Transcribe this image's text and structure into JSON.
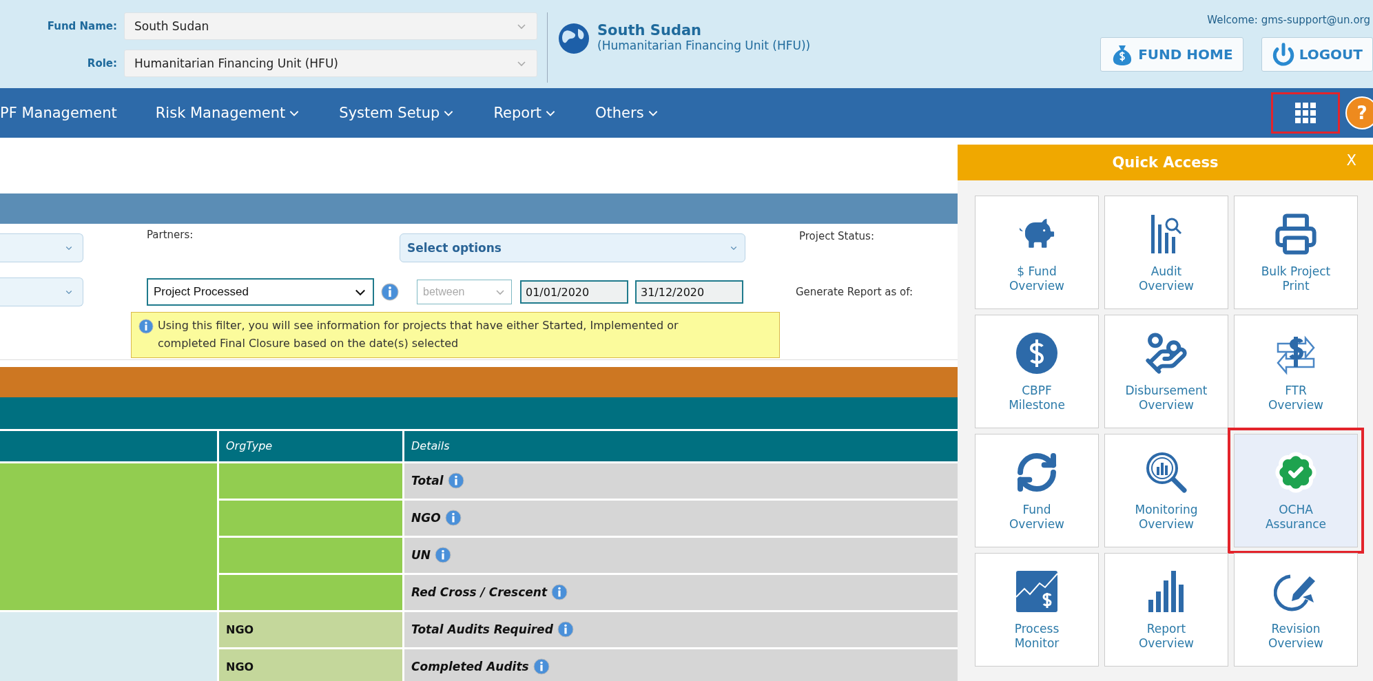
{
  "header": {
    "fund_label": "Fund Name:",
    "fund_value": "South Sudan",
    "role_label": "Role:",
    "role_value": "Humanitarian Financing Unit (HFU)",
    "fund_title": "South Sudan",
    "fund_subtitle": "(Humanitarian Financing Unit (HFU))",
    "welcome": "Welcome: gms-support@un.org",
    "buttons": [
      "FUND HOME",
      "LOGOUT"
    ]
  },
  "nav": {
    "items": [
      {
        "label": "PF Management",
        "dropdown": false
      },
      {
        "label": "Risk Management",
        "dropdown": true
      },
      {
        "label": "System Setup",
        "dropdown": true
      },
      {
        "label": "Report",
        "dropdown": true
      },
      {
        "label": "Others",
        "dropdown": true
      }
    ],
    "apps_highlighted": true,
    "help": "?"
  },
  "filters": {
    "partners_label": "Partners:",
    "partners_placeholder": "Select options",
    "status_label": "Project Status:",
    "project_filter": "Project Processed",
    "range_mode": "between",
    "date_from": "01/01/2020",
    "date_to": "31/12/2020",
    "report_label": "Generate Report as of:",
    "note": "Using this filter, you will see information for projects that have either Started, Implemented or completed Final Closure based on the date(s) selected"
  },
  "table": {
    "columns": [
      {
        "label": "OrgType"
      },
      {
        "label": "Details"
      }
    ],
    "groups": [
      {
        "color": "#92cd50",
        "rows": [
          {
            "details": "Total"
          },
          {
            "details": "NGO"
          },
          {
            "details": "UN"
          },
          {
            "details": "Red Cross / Crescent"
          }
        ]
      },
      {
        "color": "#d9ebf0",
        "rows": [
          {
            "org_type": "NGO",
            "details": "Total Audits Required"
          },
          {
            "org_type": "NGO",
            "details": "Completed Audits"
          }
        ]
      }
    ]
  },
  "quick_access": {
    "title": "Quick Access",
    "close": "X",
    "tiles": [
      {
        "label": "$ Fund\nOverview",
        "selected": false,
        "highlighted": false
      },
      {
        "label": "Audit\nOverview",
        "selected": false,
        "highlighted": false
      },
      {
        "label": "Bulk Project\nPrint",
        "selected": false,
        "highlighted": false
      },
      {
        "label": "CBPF\nMilestone",
        "selected": false,
        "highlighted": false
      },
      {
        "label": "Disbursement\nOverview",
        "selected": false,
        "highlighted": false
      },
      {
        "label": "FTR\nOverview",
        "selected": false,
        "highlighted": false
      },
      {
        "label": "Fund\nOverview",
        "selected": false,
        "highlighted": false
      },
      {
        "label": "Monitoring\nOverview",
        "selected": false,
        "highlighted": false
      },
      {
        "label": "OCHA\nAssurance",
        "selected": true,
        "highlighted": true
      },
      {
        "label": "Process\nMonitor",
        "selected": false,
        "highlighted": false
      },
      {
        "label": "Report\nOverview",
        "selected": false,
        "highlighted": false
      },
      {
        "label": "Revision\nOverview",
        "selected": false,
        "highlighted": false
      }
    ]
  }
}
